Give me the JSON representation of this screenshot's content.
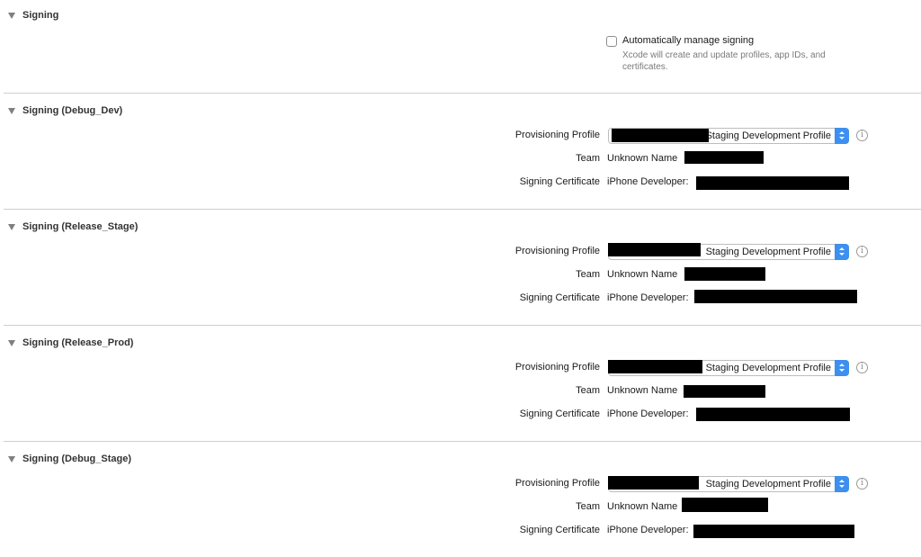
{
  "signing": {
    "title": "Signing",
    "auto_manage_label": "Automatically manage signing",
    "auto_manage_checked": false,
    "auto_manage_description": "Xcode will create and update profiles, app IDs, and certificates."
  },
  "labels": {
    "provisioning_profile": "Provisioning Profile",
    "team": "Team",
    "signing_certificate": "Signing Certificate"
  },
  "sections": [
    {
      "title": "Signing (Debug_Dev)",
      "profile_value": "Staging Development Profile",
      "team_value": "Unknown Name",
      "certificate_value": "iPhone Developer:"
    },
    {
      "title": "Signing (Release_Stage)",
      "profile_value": "Staging Development Profile",
      "team_value": "Unknown Name",
      "certificate_value": "iPhone Developer:"
    },
    {
      "title": "Signing (Release_Prod)",
      "profile_value": "Staging Development Profile",
      "team_value": "Unknown Name",
      "certificate_value": "iPhone Developer:"
    },
    {
      "title": "Signing (Debug_Stage)",
      "profile_value": "Staging Development Profile",
      "team_value": "Unknown Name",
      "certificate_value": "iPhone Developer:"
    }
  ],
  "info_icon_glyph": "i",
  "colors": {
    "popup_accent": "#3d8ff0",
    "divider": "#cfcfcf",
    "redaction": "#000000"
  }
}
